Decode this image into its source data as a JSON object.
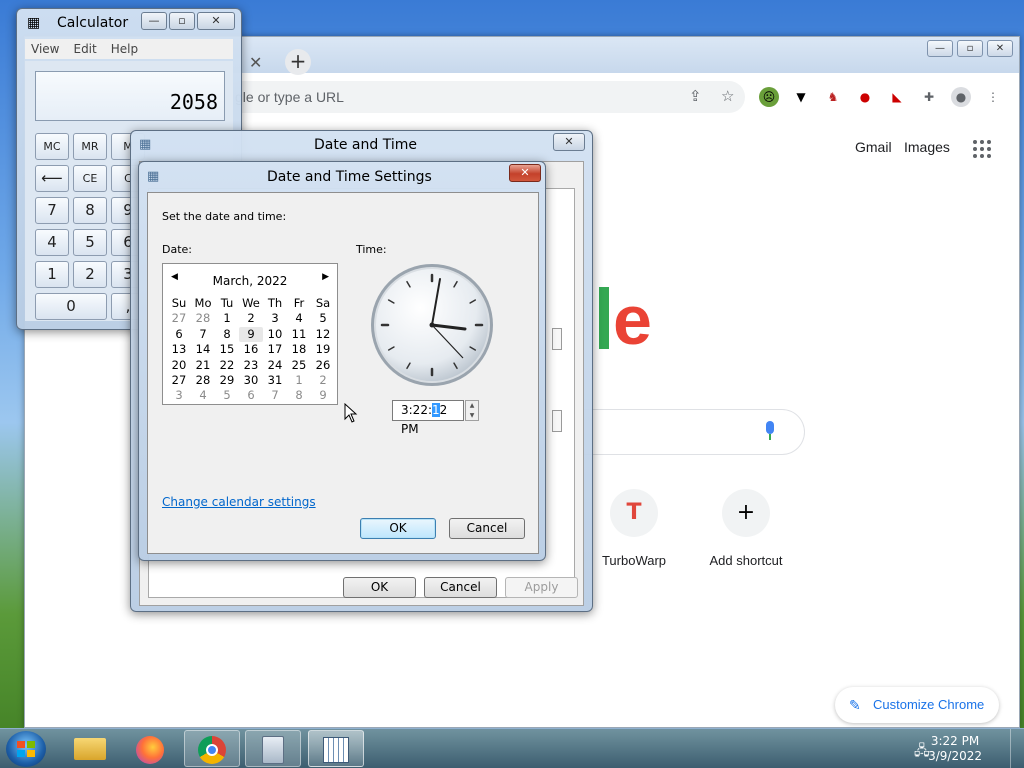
{
  "chrome": {
    "omnibox_placeholder": "gle or type a URL",
    "gmail": "Gmail",
    "images": "Images",
    "shortcuts": [
      {
        "label": "TurboWarp",
        "icon": "T"
      },
      {
        "label": "Add shortcut",
        "icon": "+"
      }
    ],
    "customize": "Customize Chrome",
    "tab_close": "✕",
    "new_tab": "+"
  },
  "calculator": {
    "title": "Calculator",
    "menu": [
      "View",
      "Edit",
      "Help"
    ],
    "display": "2058",
    "keys": {
      "mc": "MC",
      "mr": "MR",
      "ms": "M",
      "back": "⟵",
      "ce": "CE",
      "c": "C",
      "k7": "7",
      "k8": "8",
      "k9": "9",
      "k4": "4",
      "k5": "5",
      "k6": "6",
      "k1": "1",
      "k2": "2",
      "k3": "3",
      "k0": "0",
      "dot": ","
    }
  },
  "date_time": {
    "title": "Date and Time",
    "ok": "OK",
    "cancel": "Cancel",
    "apply": "Apply"
  },
  "settings": {
    "title": "Date and Time Settings",
    "instruction": "Set the date and time:",
    "date_label": "Date:",
    "time_label": "Time:",
    "month": "March, 2022",
    "weekdays": [
      "Su",
      "Mo",
      "Tu",
      "We",
      "Th",
      "Fr",
      "Sa"
    ],
    "weeks": [
      [
        "27",
        "28",
        "1",
        "2",
        "3",
        "4",
        "5"
      ],
      [
        "6",
        "7",
        "8",
        "9",
        "10",
        "11",
        "12"
      ],
      [
        "13",
        "14",
        "15",
        "16",
        "17",
        "18",
        "19"
      ],
      [
        "20",
        "21",
        "22",
        "23",
        "24",
        "25",
        "26"
      ],
      [
        "27",
        "28",
        "29",
        "30",
        "31",
        "1",
        "2"
      ],
      [
        "3",
        "4",
        "5",
        "6",
        "7",
        "8",
        "9"
      ]
    ],
    "selected_day": "9",
    "time_pre": "3:22:",
    "time_sel": "1",
    "time_post": "2 PM",
    "change_link": "Change calendar settings",
    "ok": "OK",
    "cancel": "Cancel"
  },
  "taskbar": {
    "time": "3:22 PM",
    "date": "3/9/2022"
  },
  "colors": {
    "google_red": "#ea4335",
    "google_green": "#34a853",
    "link_blue": "#0066cc"
  }
}
